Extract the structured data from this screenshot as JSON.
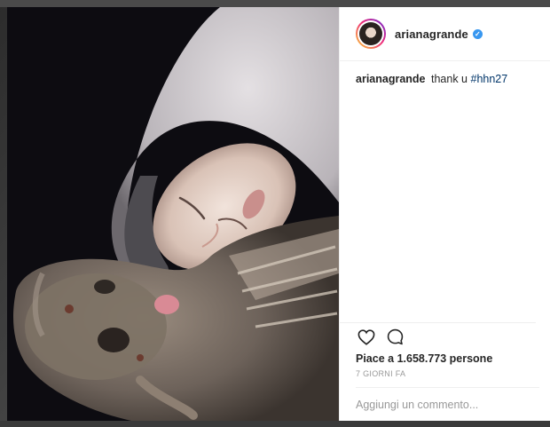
{
  "post": {
    "username": "arianagrande",
    "verified_badge": "✓",
    "caption_user": "arianagrande",
    "caption_text": "thank u",
    "caption_hashtag": "#hhn27",
    "likes_text": "Piace a 1.658.773 persone",
    "timestamp": "7 GIORNI FA",
    "comment_placeholder": "Aggiungi un commento..."
  },
  "icons": {
    "like": "heart-icon",
    "comment": "comment-bubble-icon",
    "verified": "verified-badge-icon"
  },
  "colors": {
    "verified_blue": "#3897f0",
    "hashtag_link": "#003569",
    "text_primary": "#262626",
    "text_muted": "#999999"
  }
}
